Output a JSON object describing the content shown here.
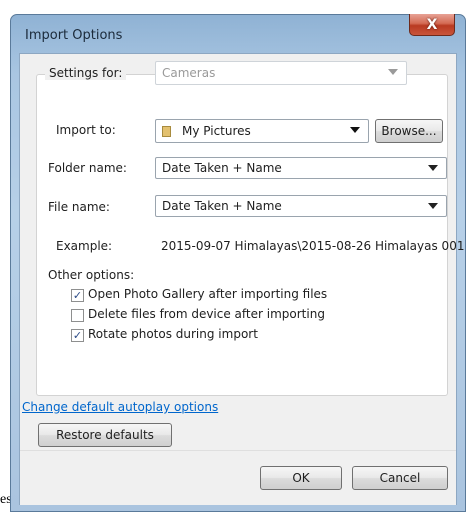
{
  "window": {
    "title": "Import Options",
    "close_glyph": "X"
  },
  "settings_for": {
    "label": "Settings for:",
    "value": "Cameras"
  },
  "import_to": {
    "label": "Import to:",
    "value": "My Pictures",
    "browse_label": "Browse..."
  },
  "folder_name": {
    "label": "Folder name:",
    "value": "Date Taken + Name"
  },
  "file_name": {
    "label": "File name:",
    "value": "Date Taken + Name"
  },
  "example": {
    "label": "Example:",
    "value": "2015-09-07 Himalayas\\2015-08-26 Himalayas 001 ..."
  },
  "other_options": {
    "label": "Other options:",
    "items": [
      {
        "label": "Open Photo Gallery after importing files",
        "checked": true
      },
      {
        "label": "Delete files from device after importing",
        "checked": false
      },
      {
        "label": "Rotate photos during import",
        "checked": true
      }
    ]
  },
  "autoplay_link": "Change default autoplay options",
  "restore_label": "Restore defaults",
  "ok_label": "OK",
  "cancel_label": "Cancel",
  "cutoff_text": "es",
  "check_glyph": "✓",
  "icons": {
    "folder": "folder-icon",
    "dropdown": "chevron-down-icon",
    "close": "close-icon"
  },
  "colors": {
    "link": "#0066cc",
    "close_button": "#c9553b",
    "window_frame": "#a9c6e2"
  }
}
